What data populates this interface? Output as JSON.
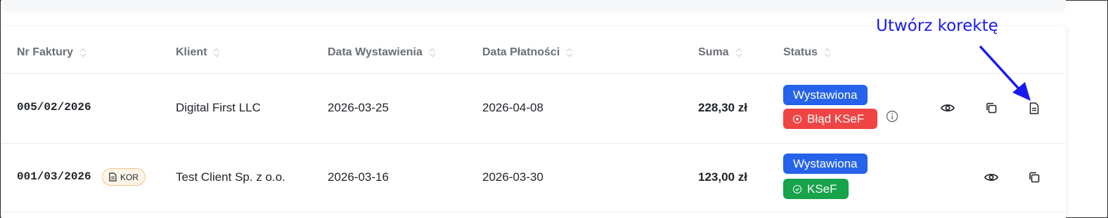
{
  "annotation": {
    "label": "Utwórz korektę",
    "color": "#1a1aee"
  },
  "table": {
    "headers": [
      "Nr Faktury",
      "Klient",
      "Data Wystawienia",
      "Data Płatności",
      "Suma",
      "Status"
    ],
    "rows": [
      {
        "invoice_no": "005/02/2026",
        "client": "Digital First LLC",
        "issue_date": "2026-03-25",
        "payment_date": "2026-04-08",
        "total": "228,30 zł",
        "status": "Wystawiona",
        "ksef_status": "Błąd KSeF",
        "actions": [
          "eye-icon",
          "copy-icon",
          "document-icon"
        ]
      },
      {
        "invoice_no": "001/03/2026",
        "badge": "KOR",
        "client": "Test Client Sp. z o.o.",
        "issue_date": "2026-03-16",
        "payment_date": "2026-03-30",
        "total": "123,00 zł",
        "status": "Wystawiona",
        "ksef_status": "KSeF",
        "actions": [
          "eye-icon",
          "copy-icon"
        ]
      }
    ]
  },
  "colors": {
    "status_blue": "#2563eb",
    "error_red": "#ef4444",
    "ok_green": "#16a34a"
  }
}
